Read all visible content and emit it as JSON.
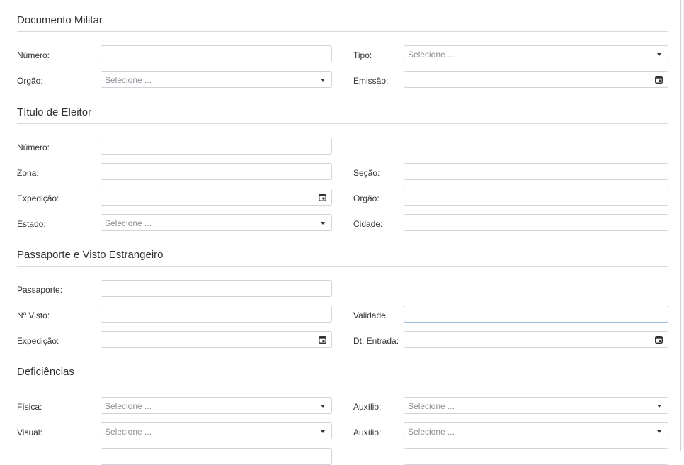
{
  "sections": {
    "militar": {
      "title": "Documento Militar",
      "numero_label": "Número:",
      "tipo_label": "Tipo:",
      "tipo_placeholder": "Selecione ...",
      "orgao_label": "Orgão:",
      "orgao_placeholder": "Selecione ...",
      "emissao_label": "Emissão:"
    },
    "eleitor": {
      "title": "Título de Eleitor",
      "numero_label": "Número:",
      "zona_label": "Zona:",
      "secao_label": "Seção:",
      "expedicao_label": "Expedição:",
      "orgao_label": "Orgão:",
      "estado_label": "Estado:",
      "estado_placeholder": "Selecione ...",
      "cidade_label": "Cidade:"
    },
    "passaporte": {
      "title": "Passaporte e Visto Estrangeiro",
      "passaporte_label": "Passaporte:",
      "visto_label": "Nº Visto:",
      "validade_label": "Validade:",
      "expedicao_label": "Expedição:",
      "entrada_label": "Dt. Entrada:"
    },
    "deficiencias": {
      "title": "Deficiências",
      "fisica_label": "Física:",
      "fisica_placeholder": "Selecione ...",
      "auxilio1_label": "Auxílio:",
      "auxilio1_placeholder": "Selecione ...",
      "visual_label": "Visual:",
      "visual_placeholder": "Selecione ...",
      "auxilio2_label": "Auxílio:",
      "auxilio2_placeholder": "Selecione ..."
    }
  }
}
